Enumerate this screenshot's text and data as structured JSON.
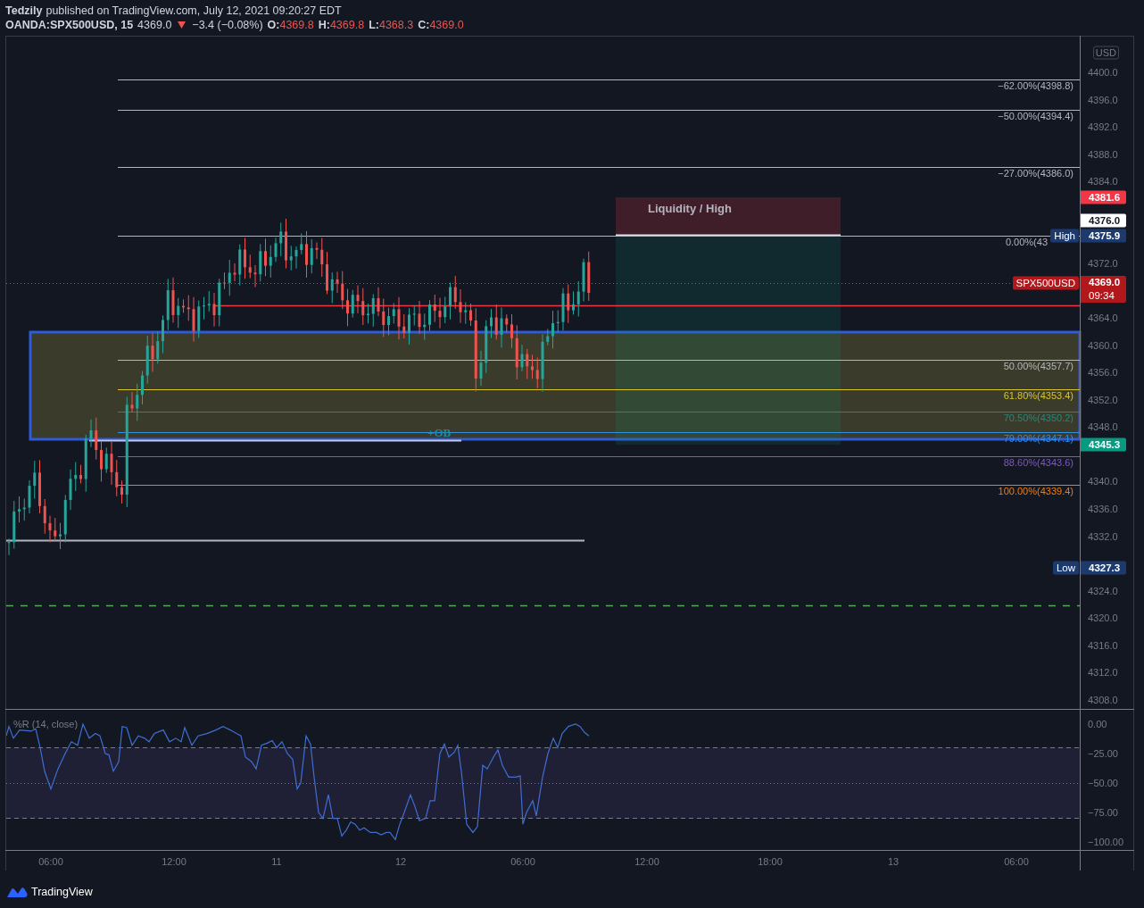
{
  "header": {
    "author": "Tedzily",
    "published": "published on TradingView.com, July 12, 2021 09:20:27 EDT"
  },
  "symbol_line": {
    "symbol": "OANDA:SPX500USD, 15",
    "last": "4369.0",
    "down": true,
    "change": "−3.4 (−0.08%)",
    "ohlc": [
      {
        "label": "O:",
        "value": "4369.8"
      },
      {
        "label": "H:",
        "value": "4369.8"
      },
      {
        "label": "L:",
        "value": "4368.3"
      },
      {
        "label": "C:",
        "value": "4369.0"
      }
    ]
  },
  "price_axis": {
    "currency": "USD",
    "ticks": [
      "4400.0",
      "4396.0",
      "4392.0",
      "4388.0",
      "4384.0",
      "4372.0",
      "4364.0",
      "4360.0",
      "4356.0",
      "4352.0",
      "4348.0",
      "4340.0",
      "4336.0",
      "4332.0",
      "4324.0",
      "4320.0",
      "4316.0",
      "4312.0",
      "4308.0"
    ]
  },
  "price_tags": [
    {
      "text": "4381.6",
      "color": "#f23645"
    },
    {
      "text": "4376.0",
      "color": "#ffffff"
    },
    {
      "text": "4375.9",
      "color": "#1c3a6e",
      "tag": "High"
    },
    {
      "text": "4369.0",
      "time": "09:34",
      "color": "#b2171b",
      "tag": "SPX500USD"
    },
    {
      "text": "4345.3",
      "color": "#089981"
    },
    {
      "text": "4327.3",
      "color": "#1c3a6e",
      "tag": "Low"
    }
  ],
  "fib_levels": [
    {
      "label": "−62.00%(4398.8)",
      "color": "#b2b5be"
    },
    {
      "label": "−50.00%(4394.4)",
      "color": "#b2b5be"
    },
    {
      "label": "−27.00%(4386.0)",
      "color": "#b2b5be"
    },
    {
      "label": "0.00%(43",
      "color": "#b2b5be"
    },
    {
      "label": "50.00%(4357.7)",
      "color": "#b2b5be"
    },
    {
      "label": "61.80%(4353.4)",
      "color": "#d8c52a"
    },
    {
      "label": "70.50%(4350.2)",
      "color": "#1f8a7f"
    },
    {
      "label": "79.00%(4347.1)",
      "color": "#2f8fe0"
    },
    {
      "label": "88.60%(4343.6)",
      "color": "#7e57c2"
    },
    {
      "label": "100.00%(4339.4)",
      "color": "#f57c00"
    }
  ],
  "annotations": {
    "liquidity": "Liquidity / High",
    "order_block": "+OB"
  },
  "indicator": {
    "title": "%R (14, close)",
    "ticks": [
      "0.00",
      "−25.00",
      "−50.00",
      "−75.00",
      "−100.00"
    ]
  },
  "time_axis": [
    "06:00",
    "12:00",
    "11",
    "12",
    "06:00",
    "12:00",
    "18:00",
    "13",
    "06:00"
  ],
  "footer": {
    "brand": "TradingView"
  }
}
